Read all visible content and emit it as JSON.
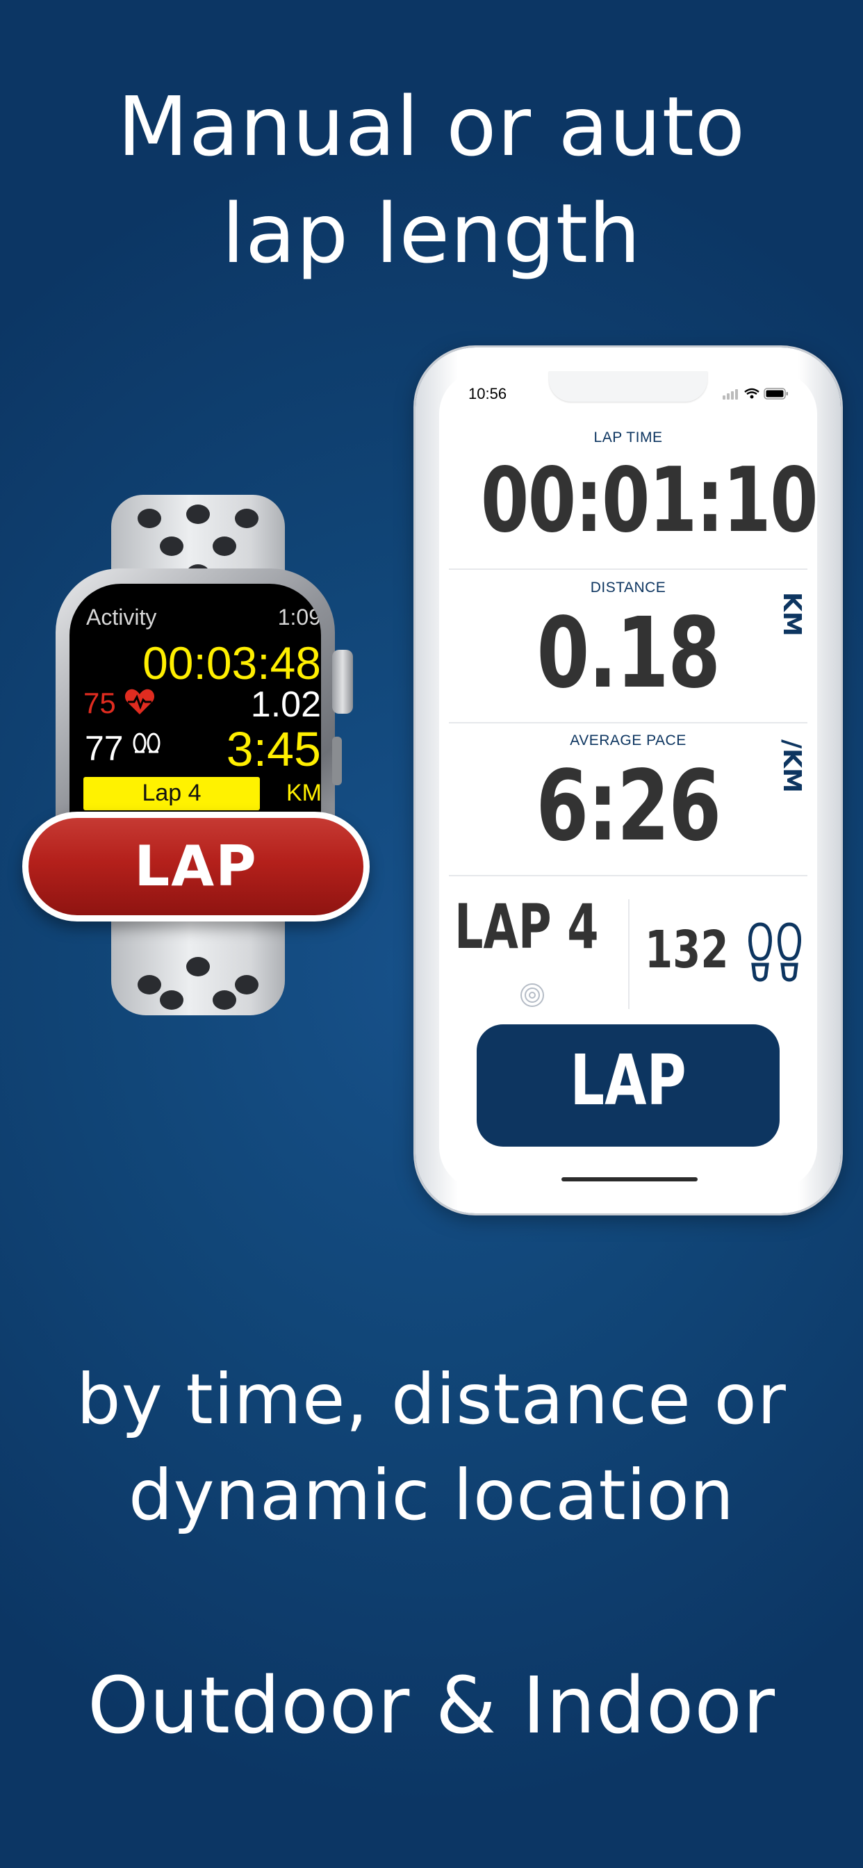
{
  "headline_top": "Manual or auto\nlap length",
  "headline_middle_lines": [
    "by time, distance or",
    "dynamic location"
  ],
  "headline_bottom": "Outdoor & Indoor",
  "watch": {
    "app_name": "Activity",
    "clock": "1:09",
    "timer": "00:03:48",
    "heart_rate": "75",
    "distance": "1.02",
    "steps": "77",
    "pace": "3:45",
    "lap_label": "Lap 4",
    "unit": "KM",
    "lap_button": "LAP"
  },
  "phone": {
    "status_time": "10:56",
    "lap_time_label": "LAP TIME",
    "lap_time_value": "00:01:10",
    "distance_label": "DISTANCE",
    "distance_value": "0.18",
    "distance_unit": "KM",
    "avg_pace_label": "AVERAGE PACE",
    "avg_pace_value": "6:26",
    "avg_pace_unit": "/KM",
    "lap_number": "LAP 4",
    "steps_value": "132",
    "lap_button": "LAP"
  },
  "colors": {
    "background": "#114678",
    "watch_timer_yellow": "#ffef00",
    "watch_heart_red": "#e02c20",
    "watch_lap_button_red": "#b4201b",
    "phone_accent_navy": "#0d3560",
    "phone_value_gray": "#333333"
  },
  "icons": [
    "heart-rate-icon",
    "footprints-icon",
    "target-icon",
    "wifi-icon",
    "cellular-icon",
    "battery-icon"
  ]
}
